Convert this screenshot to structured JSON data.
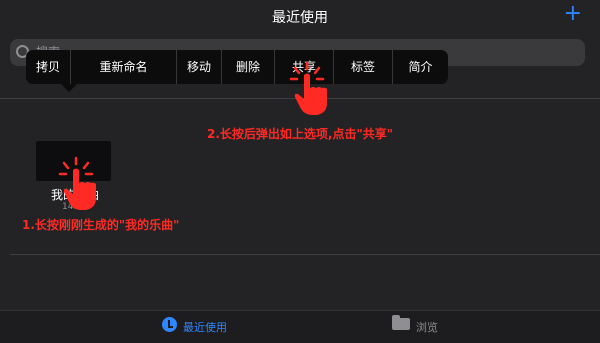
{
  "header": {
    "title": "最近使用",
    "add_label": "+"
  },
  "search": {
    "placeholder": "搜索"
  },
  "context_menu": {
    "items": [
      "拷贝",
      "重新命名",
      "移动",
      "删除",
      "共享",
      "标签",
      "简介"
    ]
  },
  "file": {
    "name": "我的乐曲",
    "time": "14:11"
  },
  "annotations": {
    "step1": "1.长按刚刚生成的\"我的乐曲\"",
    "step2": "2.长按后弹出如上选项,点击\"共享\""
  },
  "tabbar": {
    "recent": {
      "label": "最近使用",
      "icon": "clock-icon",
      "active": true,
      "color": "#2f86ff"
    },
    "browse": {
      "label": "浏览",
      "icon": "folder-icon",
      "active": false,
      "color": "#8e8e93"
    }
  },
  "colors": {
    "accent": "#2f86ff",
    "annotation": "#ff2a24",
    "background": "#232325"
  }
}
